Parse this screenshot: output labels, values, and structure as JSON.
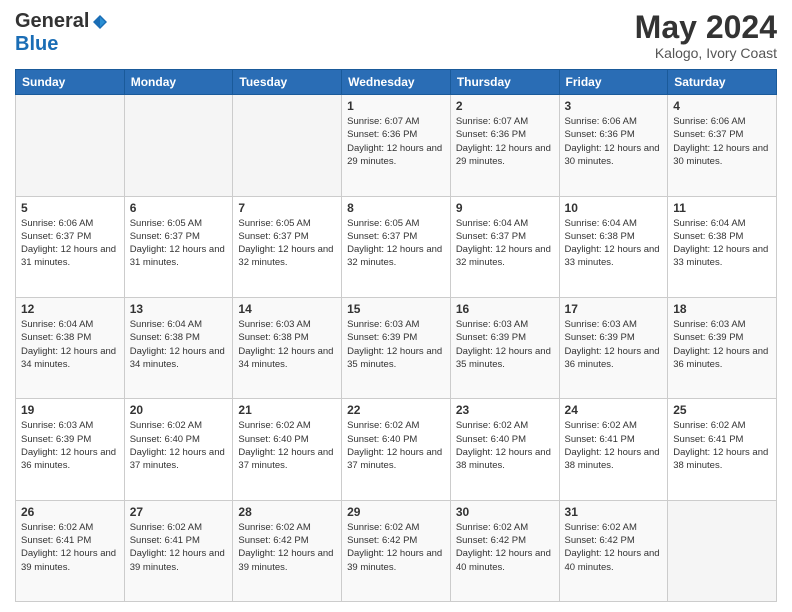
{
  "header": {
    "logo_general": "General",
    "logo_blue": "Blue",
    "title": "May 2024",
    "location": "Kalogo, Ivory Coast"
  },
  "weekdays": [
    "Sunday",
    "Monday",
    "Tuesday",
    "Wednesday",
    "Thursday",
    "Friday",
    "Saturday"
  ],
  "weeks": [
    [
      {
        "day": "",
        "info": ""
      },
      {
        "day": "",
        "info": ""
      },
      {
        "day": "",
        "info": ""
      },
      {
        "day": "1",
        "info": "Sunrise: 6:07 AM\nSunset: 6:36 PM\nDaylight: 12 hours\nand 29 minutes."
      },
      {
        "day": "2",
        "info": "Sunrise: 6:07 AM\nSunset: 6:36 PM\nDaylight: 12 hours\nand 29 minutes."
      },
      {
        "day": "3",
        "info": "Sunrise: 6:06 AM\nSunset: 6:36 PM\nDaylight: 12 hours\nand 30 minutes."
      },
      {
        "day": "4",
        "info": "Sunrise: 6:06 AM\nSunset: 6:37 PM\nDaylight: 12 hours\nand 30 minutes."
      }
    ],
    [
      {
        "day": "5",
        "info": "Sunrise: 6:06 AM\nSunset: 6:37 PM\nDaylight: 12 hours\nand 31 minutes."
      },
      {
        "day": "6",
        "info": "Sunrise: 6:05 AM\nSunset: 6:37 PM\nDaylight: 12 hours\nand 31 minutes."
      },
      {
        "day": "7",
        "info": "Sunrise: 6:05 AM\nSunset: 6:37 PM\nDaylight: 12 hours\nand 32 minutes."
      },
      {
        "day": "8",
        "info": "Sunrise: 6:05 AM\nSunset: 6:37 PM\nDaylight: 12 hours\nand 32 minutes."
      },
      {
        "day": "9",
        "info": "Sunrise: 6:04 AM\nSunset: 6:37 PM\nDaylight: 12 hours\nand 32 minutes."
      },
      {
        "day": "10",
        "info": "Sunrise: 6:04 AM\nSunset: 6:38 PM\nDaylight: 12 hours\nand 33 minutes."
      },
      {
        "day": "11",
        "info": "Sunrise: 6:04 AM\nSunset: 6:38 PM\nDaylight: 12 hours\nand 33 minutes."
      }
    ],
    [
      {
        "day": "12",
        "info": "Sunrise: 6:04 AM\nSunset: 6:38 PM\nDaylight: 12 hours\nand 34 minutes."
      },
      {
        "day": "13",
        "info": "Sunrise: 6:04 AM\nSunset: 6:38 PM\nDaylight: 12 hours\nand 34 minutes."
      },
      {
        "day": "14",
        "info": "Sunrise: 6:03 AM\nSunset: 6:38 PM\nDaylight: 12 hours\nand 34 minutes."
      },
      {
        "day": "15",
        "info": "Sunrise: 6:03 AM\nSunset: 6:39 PM\nDaylight: 12 hours\nand 35 minutes."
      },
      {
        "day": "16",
        "info": "Sunrise: 6:03 AM\nSunset: 6:39 PM\nDaylight: 12 hours\nand 35 minutes."
      },
      {
        "day": "17",
        "info": "Sunrise: 6:03 AM\nSunset: 6:39 PM\nDaylight: 12 hours\nand 36 minutes."
      },
      {
        "day": "18",
        "info": "Sunrise: 6:03 AM\nSunset: 6:39 PM\nDaylight: 12 hours\nand 36 minutes."
      }
    ],
    [
      {
        "day": "19",
        "info": "Sunrise: 6:03 AM\nSunset: 6:39 PM\nDaylight: 12 hours\nand 36 minutes."
      },
      {
        "day": "20",
        "info": "Sunrise: 6:02 AM\nSunset: 6:40 PM\nDaylight: 12 hours\nand 37 minutes."
      },
      {
        "day": "21",
        "info": "Sunrise: 6:02 AM\nSunset: 6:40 PM\nDaylight: 12 hours\nand 37 minutes."
      },
      {
        "day": "22",
        "info": "Sunrise: 6:02 AM\nSunset: 6:40 PM\nDaylight: 12 hours\nand 37 minutes."
      },
      {
        "day": "23",
        "info": "Sunrise: 6:02 AM\nSunset: 6:40 PM\nDaylight: 12 hours\nand 38 minutes."
      },
      {
        "day": "24",
        "info": "Sunrise: 6:02 AM\nSunset: 6:41 PM\nDaylight: 12 hours\nand 38 minutes."
      },
      {
        "day": "25",
        "info": "Sunrise: 6:02 AM\nSunset: 6:41 PM\nDaylight: 12 hours\nand 38 minutes."
      }
    ],
    [
      {
        "day": "26",
        "info": "Sunrise: 6:02 AM\nSunset: 6:41 PM\nDaylight: 12 hours\nand 39 minutes."
      },
      {
        "day": "27",
        "info": "Sunrise: 6:02 AM\nSunset: 6:41 PM\nDaylight: 12 hours\nand 39 minutes."
      },
      {
        "day": "28",
        "info": "Sunrise: 6:02 AM\nSunset: 6:42 PM\nDaylight: 12 hours\nand 39 minutes."
      },
      {
        "day": "29",
        "info": "Sunrise: 6:02 AM\nSunset: 6:42 PM\nDaylight: 12 hours\nand 39 minutes."
      },
      {
        "day": "30",
        "info": "Sunrise: 6:02 AM\nSunset: 6:42 PM\nDaylight: 12 hours\nand 40 minutes."
      },
      {
        "day": "31",
        "info": "Sunrise: 6:02 AM\nSunset: 6:42 PM\nDaylight: 12 hours\nand 40 minutes."
      },
      {
        "day": "",
        "info": ""
      }
    ]
  ]
}
